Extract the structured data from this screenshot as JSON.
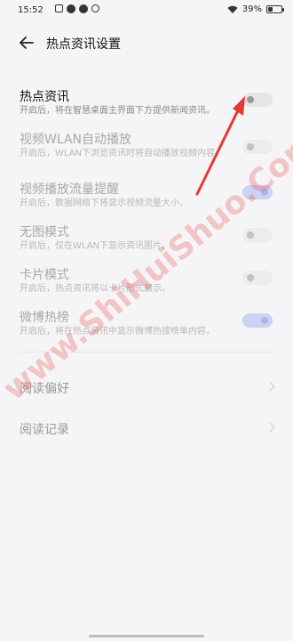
{
  "status_bar": {
    "time": "15:52",
    "battery": "39%",
    "battery_level": 0.39
  },
  "header": {
    "title": "热点资讯设置"
  },
  "settings": [
    {
      "label": "热点资讯",
      "desc": "开启后，将在智慧桌面主界面下方提供新闻资讯。",
      "toggle": "off",
      "enabled": true
    },
    {
      "label": "视频WLAN自动播放",
      "desc": "开启后，WLAN下浏览资讯时将自动播放视频内容。",
      "toggle": "off",
      "enabled": false
    },
    {
      "label": "视频播放流量提醒",
      "desc": "开启后，数据网络下将显示视频流量大小。",
      "toggle": "on",
      "enabled": false
    },
    {
      "label": "无图模式",
      "desc": "开启后，仅在WLAN下显示资讯图片。",
      "toggle": "off",
      "enabled": false
    },
    {
      "label": "卡片模式",
      "desc": "开启后，热点资讯将以卡片形式展示。",
      "toggle": "off",
      "enabled": false
    },
    {
      "label": "微博热榜",
      "desc": "开启后，将在热点资讯中显示微博热搜榜单内容。",
      "toggle": "on",
      "enabled": false
    }
  ],
  "links": [
    {
      "label": "阅读偏好"
    },
    {
      "label": "阅读记录"
    }
  ],
  "watermark": "www.ShiHuiShuo.Com 适会说",
  "colors": {
    "accent": "#6c84e0",
    "arrow": "#e53935",
    "background": "#f5f5f7"
  }
}
